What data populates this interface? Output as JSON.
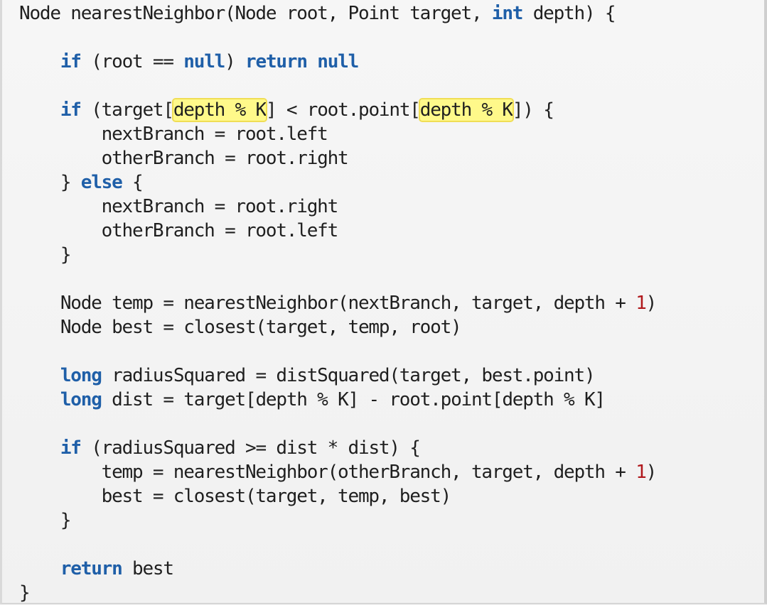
{
  "code": {
    "lines": [
      [
        {
          "t": "Node nearestNeighbor(Node root, Point target, "
        },
        {
          "t": "int",
          "c": "kw"
        },
        {
          "t": " depth) {"
        }
      ],
      [],
      [
        {
          "t": "    "
        },
        {
          "t": "if",
          "c": "kw"
        },
        {
          "t": " (root == "
        },
        {
          "t": "null",
          "c": "kw"
        },
        {
          "t": ") "
        },
        {
          "t": "return",
          "c": "kw"
        },
        {
          "t": " "
        },
        {
          "t": "null",
          "c": "kw"
        }
      ],
      [],
      [
        {
          "t": "    "
        },
        {
          "t": "if",
          "c": "kw"
        },
        {
          "t": " (target["
        },
        {
          "t": "depth % K",
          "c": "hl"
        },
        {
          "t": "] < root.point["
        },
        {
          "t": "depth % K",
          "c": "hl"
        },
        {
          "t": "]) {"
        }
      ],
      [
        {
          "t": "        nextBranch = root.left"
        }
      ],
      [
        {
          "t": "        otherBranch = root.right"
        }
      ],
      [
        {
          "t": "    } "
        },
        {
          "t": "else",
          "c": "kw"
        },
        {
          "t": " {"
        }
      ],
      [
        {
          "t": "        nextBranch = root.right"
        }
      ],
      [
        {
          "t": "        otherBranch = root.left"
        }
      ],
      [
        {
          "t": "    }"
        }
      ],
      [],
      [
        {
          "t": "    Node temp = nearestNeighbor(nextBranch, target, depth + "
        },
        {
          "t": "1",
          "c": "num"
        },
        {
          "t": ")"
        }
      ],
      [
        {
          "t": "    Node best = closest(target, temp, root)"
        }
      ],
      [],
      [
        {
          "t": "    "
        },
        {
          "t": "long",
          "c": "kw"
        },
        {
          "t": " radiusSquared = distSquared(target, best.point)"
        }
      ],
      [
        {
          "t": "    "
        },
        {
          "t": "long",
          "c": "kw"
        },
        {
          "t": " dist = target[depth % K] - root.point[depth % K]"
        }
      ],
      [],
      [
        {
          "t": "    "
        },
        {
          "t": "if",
          "c": "kw"
        },
        {
          "t": " (radiusSquared >= dist * dist) {"
        }
      ],
      [
        {
          "t": "        temp = nearestNeighbor(otherBranch, target, depth + "
        },
        {
          "t": "1",
          "c": "num"
        },
        {
          "t": ")"
        }
      ],
      [
        {
          "t": "        best = closest(target, temp, best)"
        }
      ],
      [
        {
          "t": "    }"
        }
      ],
      [],
      [
        {
          "t": "    "
        },
        {
          "t": "return",
          "c": "kw"
        },
        {
          "t": " best"
        }
      ],
      [
        {
          "t": "}"
        }
      ]
    ]
  }
}
